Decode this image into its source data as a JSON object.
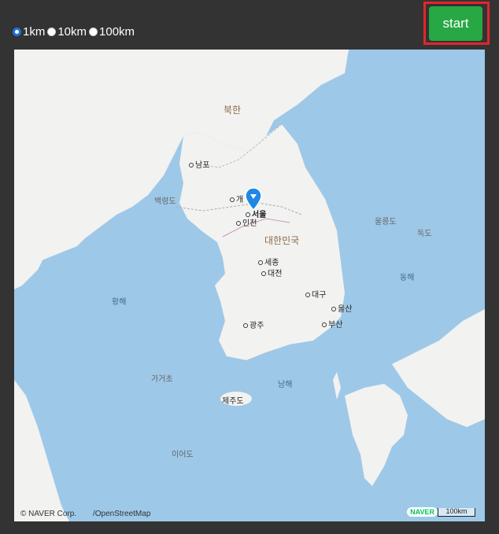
{
  "radius_options": [
    {
      "label": "1km",
      "checked": true
    },
    {
      "label": "10km",
      "checked": false
    },
    {
      "label": "100km",
      "checked": false
    }
  ],
  "start_button": {
    "label": "start"
  },
  "map": {
    "labels": {
      "north_korea": "북한",
      "south_korea": "대한민국",
      "nampo": "남포",
      "baengnyeongdo": "백령도",
      "gaeseong": "개",
      "seoul": "서울",
      "incheon": "인천",
      "ulleungdo": "울릉도",
      "dokdo": "독도",
      "sejong": "세종",
      "daejeon": "대전",
      "east_sea": "동해",
      "yellow_sea": "황해",
      "daegu": "대구",
      "ulsan": "울산",
      "busan": "부산",
      "gwangju": "광주",
      "gageocho": "가거초",
      "south_sea": "남해",
      "jejudo": "제주도",
      "ieodo": "이어도"
    },
    "copyright": "© NAVER Corp.",
    "osm": "/OpenStreetMap",
    "naver_logo": "NAVER",
    "scale": "100km"
  }
}
